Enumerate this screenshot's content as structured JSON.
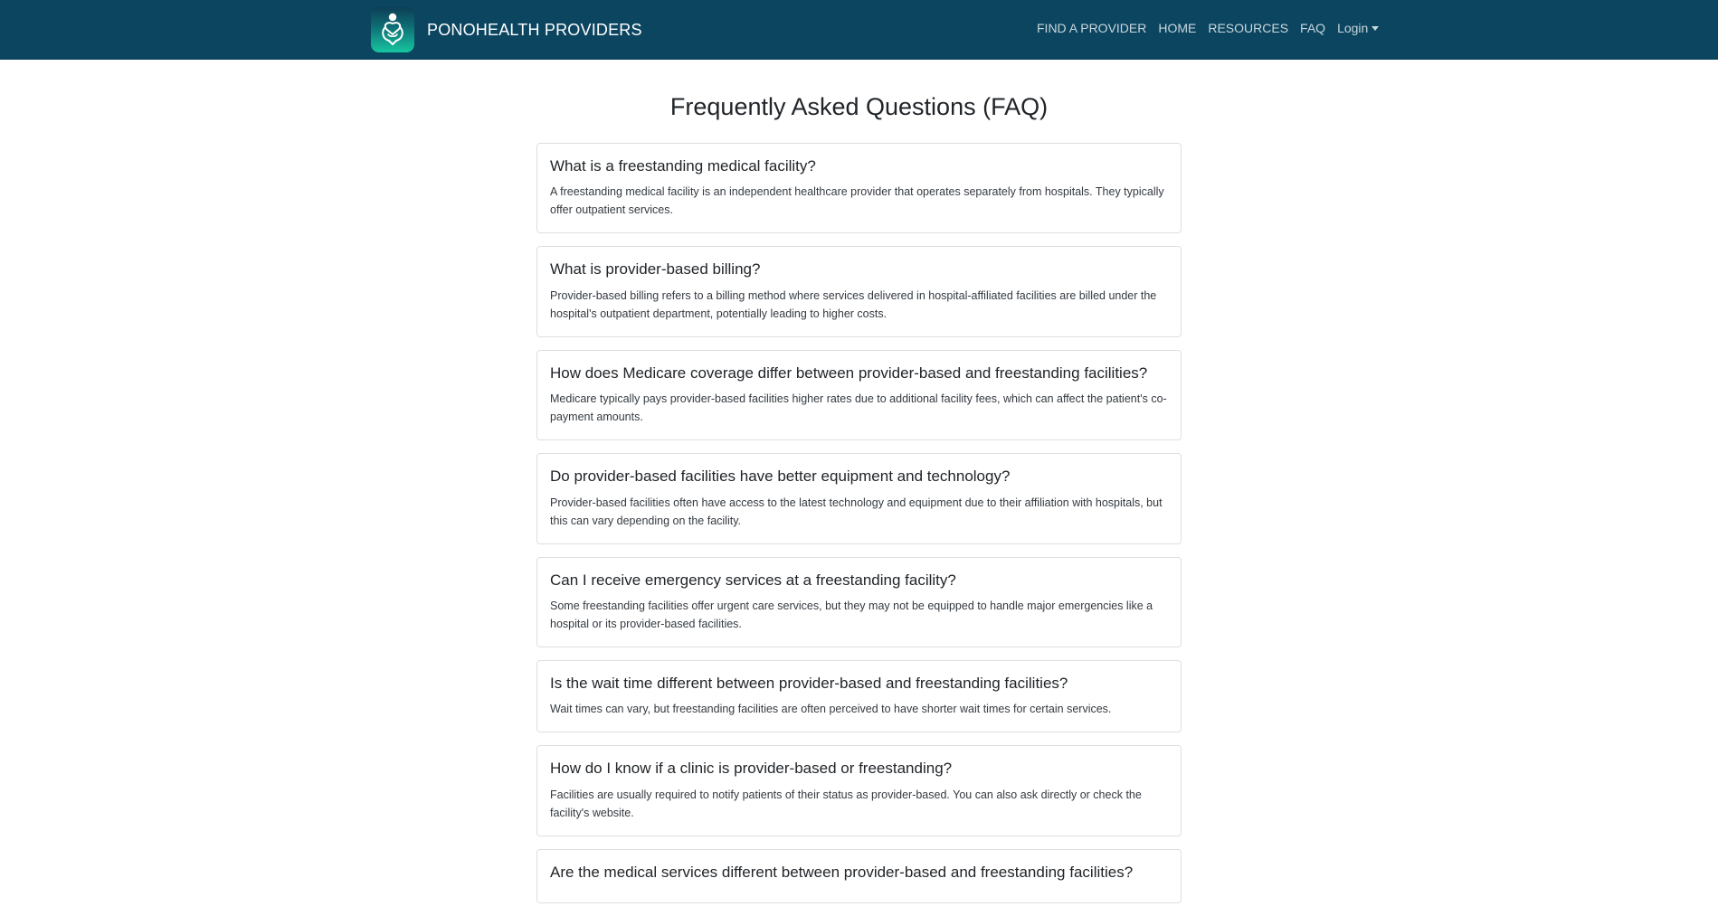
{
  "brand": {
    "name": "PONOHEALTH PROVIDERS",
    "logo_icon": "hands-heart-icon",
    "colors": {
      "navbar": "#0b4560",
      "logo_top": "#0d3f56",
      "logo_bottom": "#17c6a0"
    }
  },
  "nav": {
    "find_provider": "FIND A PROVIDER",
    "home": "HOME",
    "resources": "RESOURCES",
    "faq": "FAQ",
    "login": "Login"
  },
  "page": {
    "title": "Frequently Asked Questions (FAQ)"
  },
  "faqs": [
    {
      "question": "What is a freestanding medical facility?",
      "answer": "A freestanding medical facility is an independent healthcare provider that operates separately from hospitals. They typically offer outpatient services."
    },
    {
      "question": "What is provider-based billing?",
      "answer": "Provider-based billing refers to a billing method where services delivered in hospital-affiliated facilities are billed under the hospital's outpatient department, potentially leading to higher costs."
    },
    {
      "question": "How does Medicare coverage differ between provider-based and freestanding facilities?",
      "answer": "Medicare typically pays provider-based facilities higher rates due to additional facility fees, which can affect the patient's co-payment amounts."
    },
    {
      "question": "Do provider-based facilities have better equipment and technology?",
      "answer": "Provider-based facilities often have access to the latest technology and equipment due to their affiliation with hospitals, but this can vary depending on the facility."
    },
    {
      "question": "Can I receive emergency services at a freestanding facility?",
      "answer": "Some freestanding facilities offer urgent care services, but they may not be equipped to handle major emergencies like a hospital or its provider-based facilities."
    },
    {
      "question": "Is the wait time different between provider-based and freestanding facilities?",
      "answer": "Wait times can vary, but freestanding facilities are often perceived to have shorter wait times for certain services."
    },
    {
      "question": "How do I know if a clinic is provider-based or freestanding?",
      "answer": "Facilities are usually required to notify patients of their status as provider-based. You can also ask directly or check the facility's website."
    },
    {
      "question": "Are the medical services different between provider-based and freestanding facilities?",
      "answer": ""
    }
  ]
}
